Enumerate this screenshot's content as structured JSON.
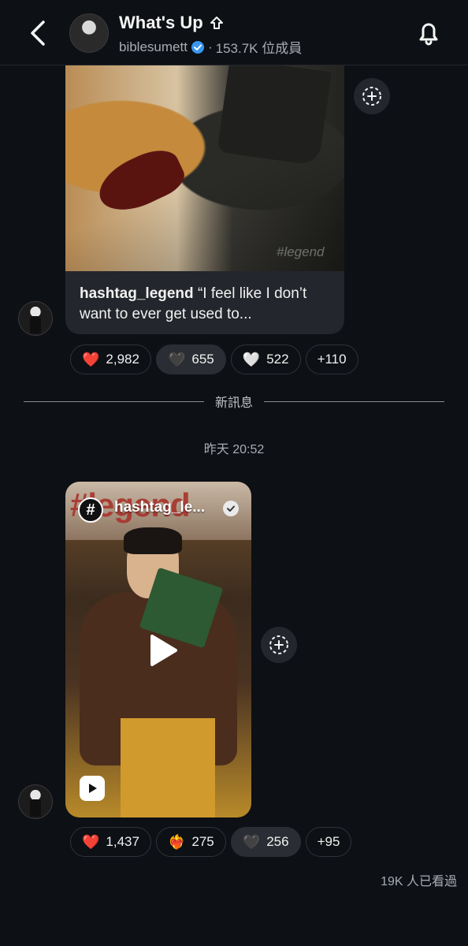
{
  "header": {
    "back_icon": "chevron-left-icon",
    "title": "What's Up",
    "title_icon": "share-up-arrow-icon",
    "username": "biblesumett",
    "member_count": "153.7K 位成員",
    "separator": "·",
    "notification_icon": "bell-icon",
    "verified_color": "#3897f0"
  },
  "message1": {
    "image_watermark": "#legend",
    "caption_user": "hashtag_legend",
    "caption_text": "“I feel like I don’t want to ever get used to...",
    "share_icon": "add-share-icon",
    "reactions": [
      {
        "emoji": "❤️",
        "count": "2,982",
        "selected": false
      },
      {
        "emoji": "🖤",
        "count": "655",
        "selected": true
      },
      {
        "emoji": "🤍",
        "count": "522",
        "selected": false
      }
    ],
    "more_count": "+110"
  },
  "divider_label": "新訊息",
  "timestamp": "昨天 20:52",
  "message2": {
    "reel_user": "hashtag_le...",
    "reel_bigword": "#legend",
    "reel_badge": "#",
    "reactions": [
      {
        "emoji": "❤️",
        "count": "1,437",
        "selected": false
      },
      {
        "emoji": "❤️‍🔥",
        "count": "275",
        "selected": false
      },
      {
        "emoji": "🖤",
        "count": "256",
        "selected": true
      }
    ],
    "more_count": "+95"
  },
  "seen_count": "19K 人已看過",
  "colors": {
    "background": "#0d1014",
    "pill_border": "#2f343b",
    "pill_selected": "#2a2d33",
    "muted_text": "#a8adb4"
  }
}
